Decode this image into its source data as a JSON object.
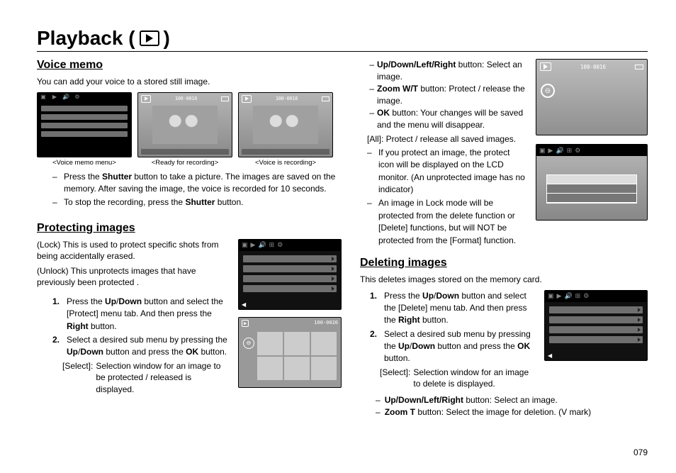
{
  "title": {
    "prefix": "Playback (",
    "suffix": ")"
  },
  "voice_memo": {
    "heading": "Voice memo",
    "intro": "You can add your voice to a stored still image.",
    "captions": {
      "menu": "<Voice memo menu>",
      "ready": "<Ready for recording>",
      "recording": "<Voice is recording>"
    },
    "thumb_label": "100-0016",
    "bullets": [
      "Press the Shutter button to take a picture. The images are saved on the memory. After saving the image, the voice is recorded for 10 seconds.",
      "To stop the recording, press the Shutter button."
    ],
    "bullet_bold": {
      "0": [
        "Shutter"
      ],
      "1": [
        "Shutter"
      ]
    }
  },
  "protecting": {
    "heading": "Protecting images",
    "intro1": "(Lock) This is used to protect specific shots from being accidentally erased.",
    "intro2": "(Unlock) This unprotects images that have previously been protected .",
    "steps": [
      "Press the Up/Down button and select the [Protect] menu tab. And then press the Right button.",
      "Select a desired sub menu by pressing the Up/Down button and press the OK button."
    ],
    "step_bold": {
      "0": [
        "Up/Down",
        "Right"
      ],
      "1": [
        "Up/Down",
        "OK"
      ]
    },
    "select_label": "[Select]:",
    "select_text": "Selection window for an image to be protected / released is displayed.",
    "thumb2_label": "100-0020"
  },
  "right_top": {
    "ctrl_updown": {
      "dash": "–",
      "lab": "Up/Down/Left/Right",
      "lab_suffix": " button:",
      "val": "Select an image."
    },
    "ctrl_zoom": {
      "dash": "–",
      "lab": "Zoom W/T",
      "lab_suffix": " button:",
      "val": "Protect / release the image."
    },
    "ctrl_ok": {
      "dash": "–",
      "lab": "OK",
      "lab_suffix": " button:",
      "val": "Your changes will be saved and the menu will disappear."
    },
    "all": "[All]: Protect / release all saved images.",
    "notes": [
      "If you protect an image, the protect icon will be displayed on the LCD monitor. (An unprotected image has no indicator)",
      "An image in Lock mode will be protected from the delete function or [Delete] functions, but will NOT be protected from the [Format] function."
    ],
    "thumb1_label": "100-0016"
  },
  "deleting": {
    "heading": "Deleting images",
    "intro": "This deletes images stored on the memory card.",
    "steps": [
      "Press the Up/Down button and select the [Delete] menu tab. And then press the Right button.",
      "Select a desired sub menu by pressing the Up/Down button and press the OK button."
    ],
    "step_bold": {
      "0": [
        "Up/Down",
        "Right"
      ],
      "1": [
        "Up/Down",
        "OK"
      ]
    },
    "select_label": "[Select]:",
    "select_text": "Selection window for an image to delete is displayed.",
    "tail1": {
      "dash": "–",
      "lab": "Up/Down/Left/Right",
      "lab_suffix": " button: Select an image."
    },
    "tail2": {
      "dash": "–",
      "lab": "Zoom T",
      "lab_suffix": " button: Select the image for deletion. (V mark)"
    }
  },
  "page_number": "079"
}
